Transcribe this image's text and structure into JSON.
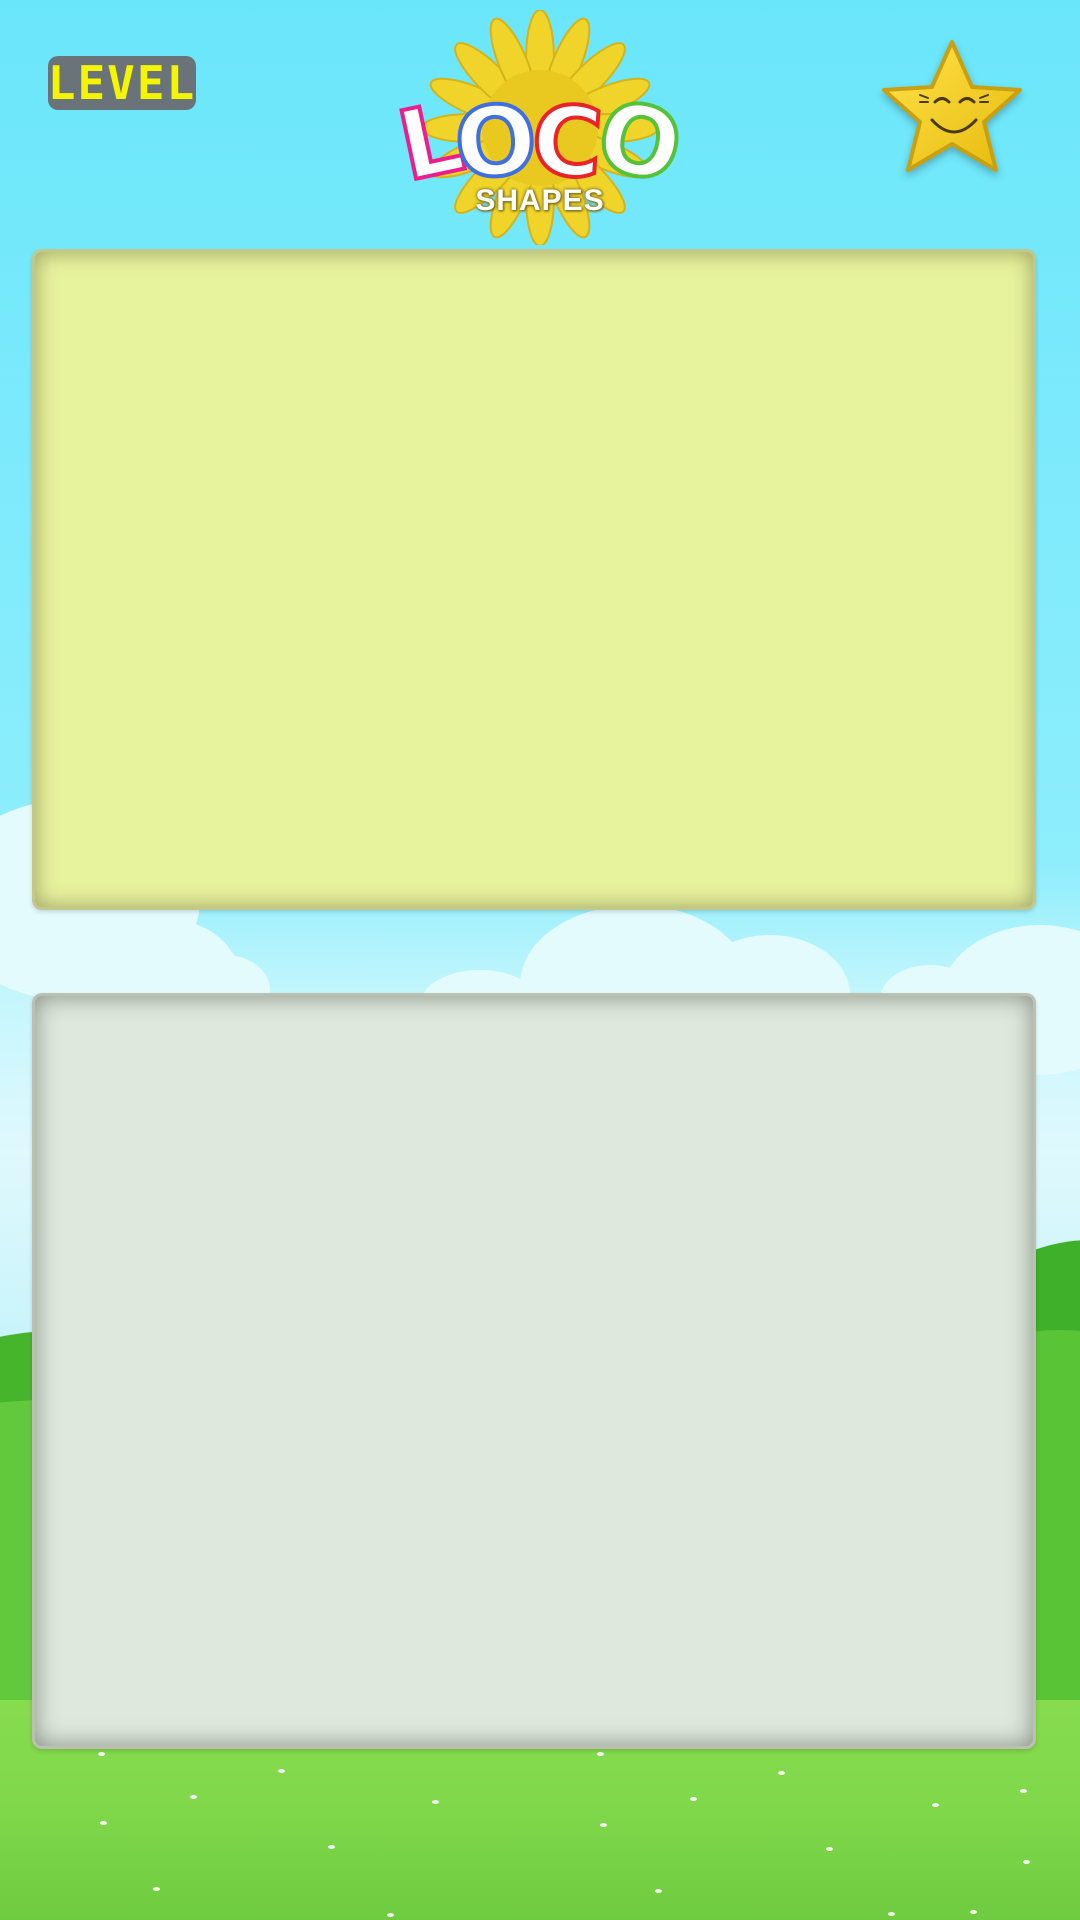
{
  "header": {
    "level_label": "LEVEL",
    "logo_title_letters": [
      "L",
      "O",
      "C",
      "O"
    ],
    "logo_subtitle": "SHAPES"
  },
  "colors": {
    "sky_top": "#6ae6fb",
    "level_text": "#f4f500",
    "level_badge_bg": "#6b737a",
    "top_panel": "#e8f39d",
    "bottom_panel": "#dfe8dc",
    "grass": "#7fd84a",
    "star": "#f7d21a",
    "logo_letter_colors": [
      "#ee1c8c",
      "#3f6fe0",
      "#e8232a",
      "#56c23a"
    ]
  },
  "icons": {
    "star_button": "smiling-star-icon",
    "logo_background": "sunflower-icon"
  }
}
